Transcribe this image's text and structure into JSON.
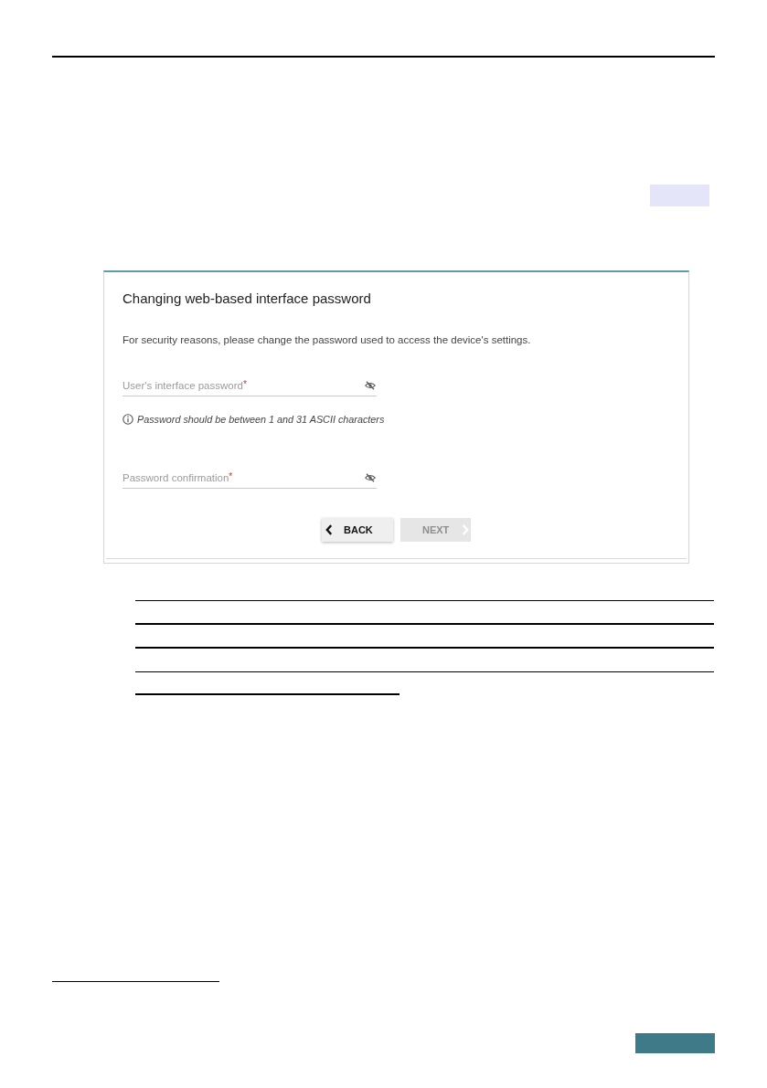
{
  "panel": {
    "title": "Changing web-based interface password",
    "description": "For security reasons, please change the password used to access the device's settings.",
    "fields": [
      {
        "placeholder": "User's interface password",
        "required_mark": "*",
        "hint": "Password should be between 1 and 31 ASCII characters"
      },
      {
        "placeholder": "Password confirmation",
        "required_mark": "*"
      }
    ],
    "buttons": [
      {
        "label": "BACK",
        "kind": "back",
        "disabled": false
      },
      {
        "label": "NEXT",
        "kind": "next",
        "disabled": true
      }
    ]
  }
}
